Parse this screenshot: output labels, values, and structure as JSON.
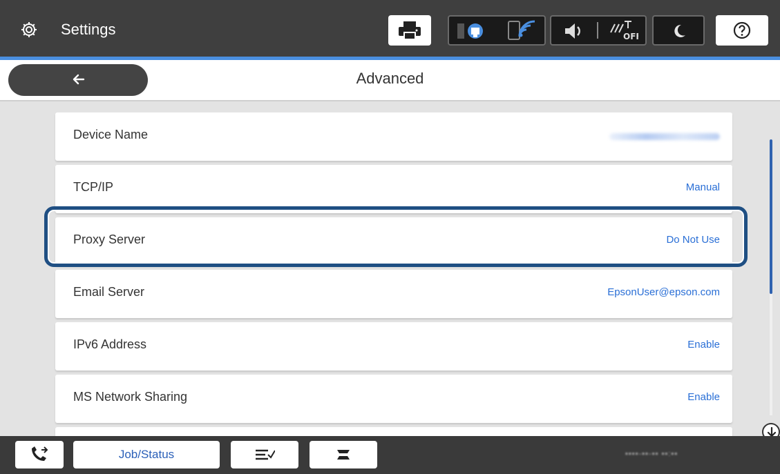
{
  "header": {
    "title": "Settings"
  },
  "page": {
    "title": "Advanced"
  },
  "list": [
    {
      "label": "Device Name",
      "value": ""
    },
    {
      "label": "TCP/IP",
      "value": "Manual"
    },
    {
      "label": "Proxy Server",
      "value": "Do Not Use"
    },
    {
      "label": "Email Server",
      "value": "EpsonUser@epson.com"
    },
    {
      "label": "IPv6 Address",
      "value": "Enable"
    },
    {
      "label": "MS Network Sharing",
      "value": "Enable"
    }
  ],
  "bottom": {
    "job_status_label": "Job/Status"
  },
  "icons": {
    "gear": "gear-icon",
    "printer": "printer-icon",
    "ethernet": "ethernet-icon",
    "wifi": "wifi-icon",
    "speaker": "speaker-icon",
    "wifi_direct": "wifi-direct-off-icon",
    "sleep": "moon-icon",
    "help": "help-icon",
    "back": "back-arrow-icon",
    "scroll_down": "arrow-down-icon",
    "fax": "fax-icon",
    "stack": "stack-icon",
    "paper": "paper-icon"
  },
  "colors": {
    "top_bar": "#3f3f3f",
    "accent_line": "#4a8fe0",
    "value_text": "#2a6fd6",
    "highlight_border": "#1f4f83",
    "scroll_thumb": "#2f62b0"
  },
  "scroll": {
    "visible_fraction": 0.56
  }
}
